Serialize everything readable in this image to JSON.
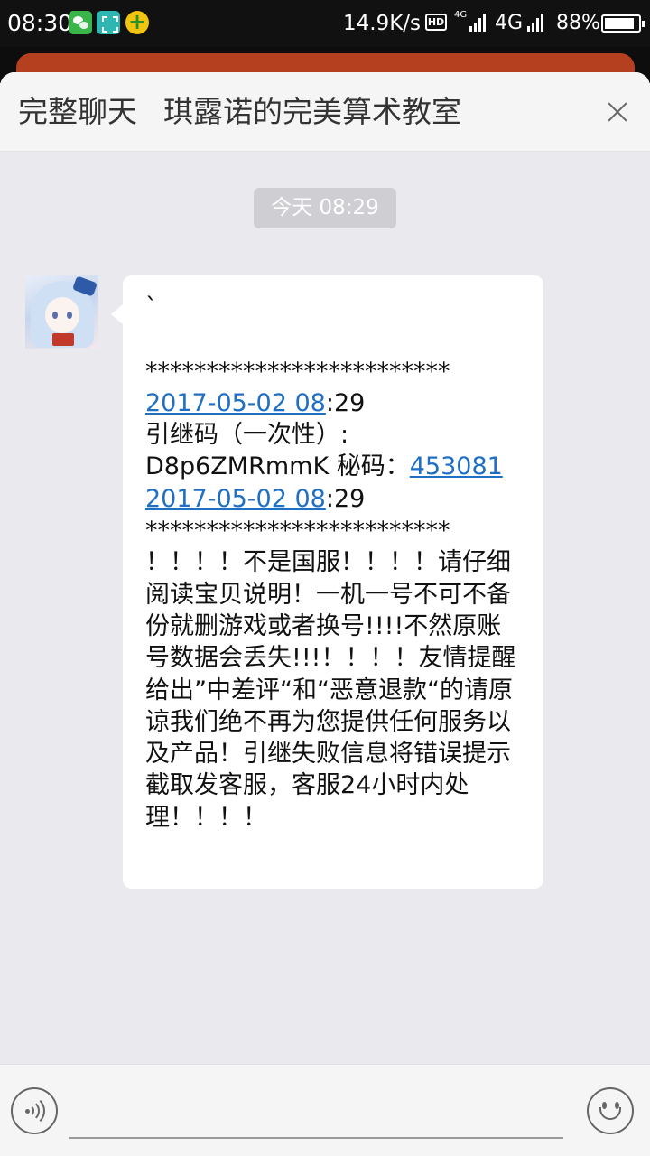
{
  "status_bar": {
    "time": "08:30",
    "app_icons": [
      "wechat-icon",
      "scan-icon",
      "plus-app-icon"
    ],
    "net_speed": "14.9K/s",
    "hd_label": "HD",
    "network_small": "4G",
    "network": "4G",
    "battery": "88%",
    "battery_level": 0.88
  },
  "header": {
    "label": "完整聊天",
    "title": "琪露诺的完美算术教室",
    "close_icon": "close-icon"
  },
  "chat": {
    "timestamp": "今天 08:29",
    "message": {
      "line_backtick": "`",
      "stars_1": "*************************",
      "date_1": "2017-05-02 08",
      "time_suffix_1": ":29",
      "line_code_label": "引继码（一次性）:",
      "code_text": "D8p6ZMRmmK 秘码：",
      "secret_code": "453081",
      "date_2": "2017-05-02 08",
      "time_suffix_2": ":29",
      "stars_2": "*************************",
      "body": "！！！！不是国服！！！！请仔细阅读宝贝说明！一机一号不可不备份就删游戏或者换号!!!!不然原账号数据会丢失!!!！！！！友情提醒给出”中差评“和“恶意退款“的请原谅我们绝不再为您提供任何服务以及产品！引继失败信息将错误提示截取发客服，客服24小时内处理！！！！"
    }
  },
  "input": {
    "placeholder": "",
    "value": "",
    "voice_icon": "voice-icon",
    "emoji_icon": "emoji-icon"
  }
}
